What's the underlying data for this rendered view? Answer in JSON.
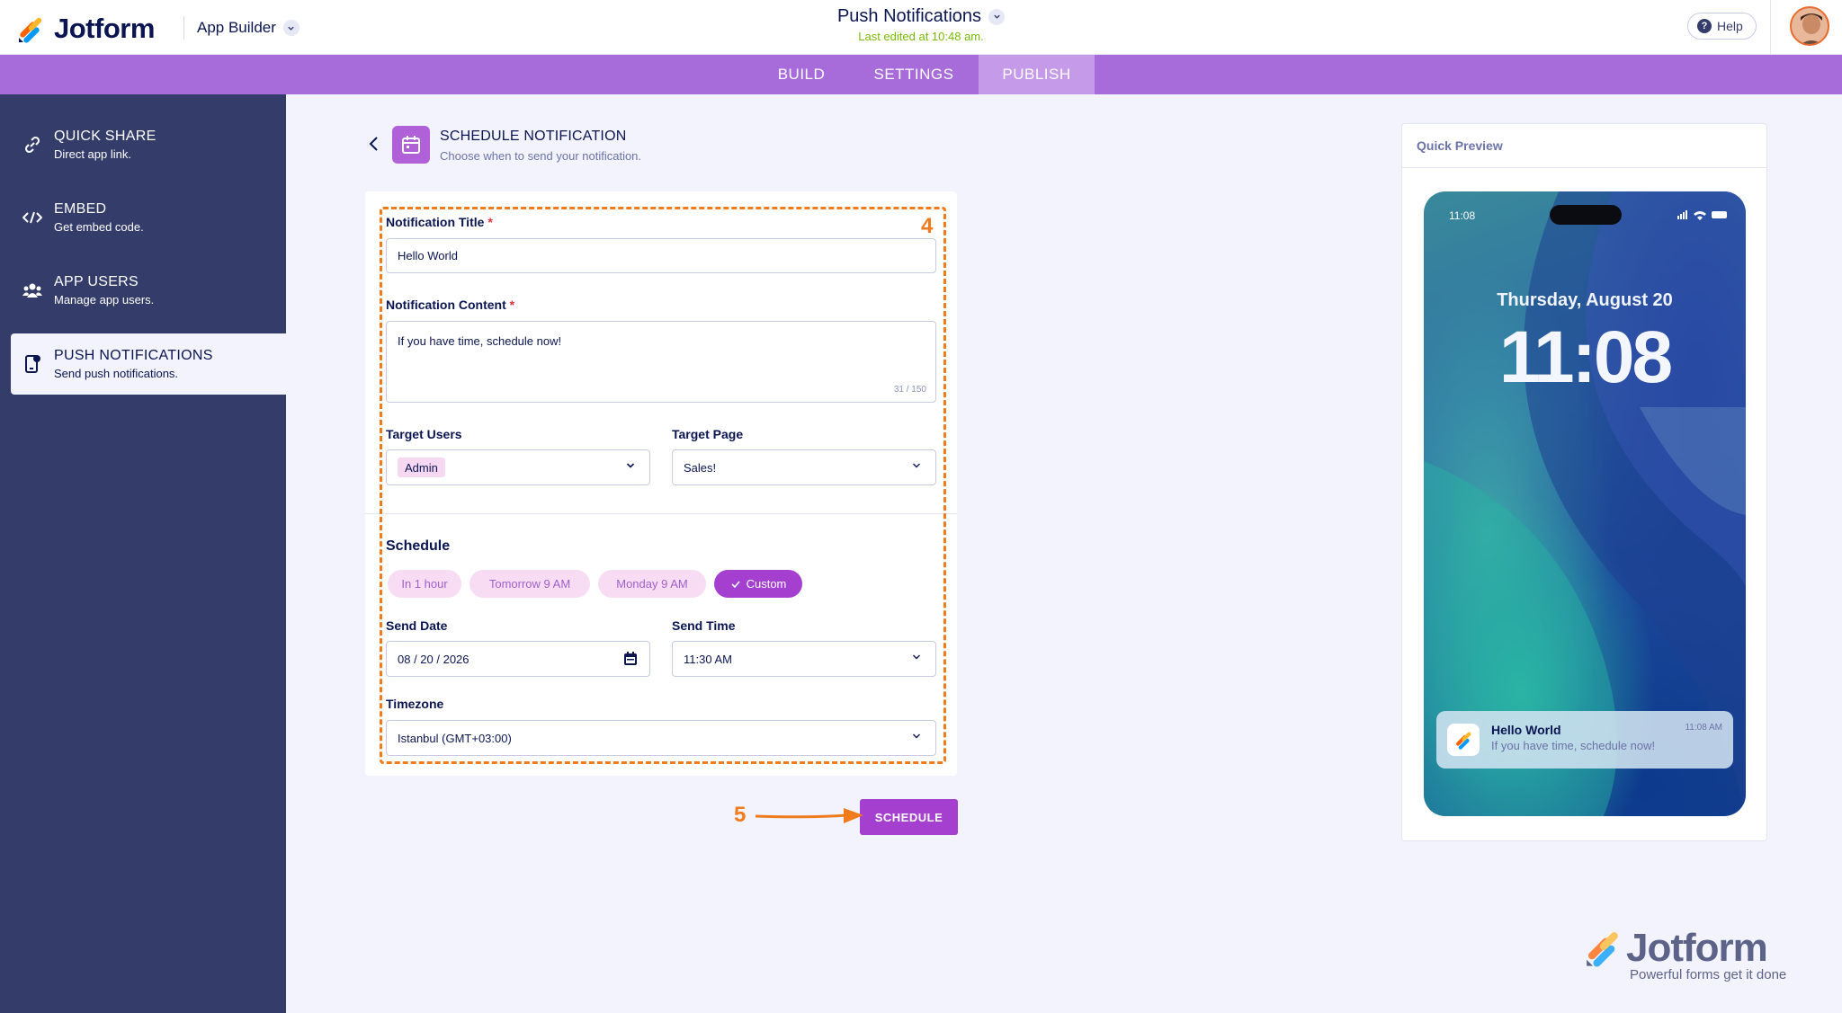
{
  "header": {
    "logo_text": "Jotform",
    "app_builder_label": "App Builder",
    "app_title": "Push Notifications",
    "last_edited": "Last edited at 10:48 am.",
    "help_label": "Help"
  },
  "tabs": [
    {
      "label": "BUILD",
      "active": false
    },
    {
      "label": "SETTINGS",
      "active": false
    },
    {
      "label": "PUBLISH",
      "active": true
    }
  ],
  "sidebar": {
    "items": [
      {
        "title": "QUICK SHARE",
        "subtitle": "Direct app link.",
        "icon": "link-icon",
        "active": false
      },
      {
        "title": "EMBED",
        "subtitle": "Get embed code.",
        "icon": "code-icon",
        "active": false
      },
      {
        "title": "APP USERS",
        "subtitle": "Manage app users.",
        "icon": "users-icon",
        "active": false
      },
      {
        "title": "PUSH NOTIFICATIONS",
        "subtitle": "Send push notifications.",
        "icon": "phone-notification-icon",
        "active": true
      }
    ]
  },
  "schedule_header": {
    "title": "SCHEDULE NOTIFICATION",
    "subtitle": "Choose when to send your notification."
  },
  "form": {
    "notification_title_label": "Notification Title",
    "notification_title_value": "Hello World",
    "notification_content_label": "Notification Content",
    "notification_content_value": "If you have time, schedule now!",
    "char_counter": "31 / 150",
    "required_mark": "*",
    "target_users_label": "Target Users",
    "target_users_value": "Admin",
    "target_page_label": "Target Page",
    "target_page_value": "Sales!",
    "schedule_label": "Schedule",
    "schedule_options": [
      "In 1 hour",
      "Tomorrow 9 AM",
      "Monday 9 AM",
      "Custom"
    ],
    "schedule_selected": "Custom",
    "send_date_label": "Send Date",
    "send_date_value": "08 / 20 / 2026",
    "send_time_label": "Send Time",
    "send_time_value": "11:30 AM",
    "timezone_label": "Timezone",
    "timezone_value": "Istanbul (GMT+03:00)",
    "schedule_button": "SCHEDULE"
  },
  "annotations": {
    "step_4": "4",
    "step_5": "5",
    "color": "#f07b1d"
  },
  "preview": {
    "heading": "Quick Preview",
    "status_time": "11:08",
    "date": "Thursday, August 20",
    "clock": "11:08",
    "notification_title": "Hello World",
    "notification_body": "If you have time, schedule now!",
    "notification_time": "11:08 AM"
  },
  "watermark": {
    "word": "Jotform",
    "tagline": "Powerful forms get it done"
  },
  "colors": {
    "accent_purple": "#a43fd0",
    "tabbar": "#a86bda",
    "sidebar_bg": "#343c6a",
    "navy_text": "#0a1551",
    "edited_green": "#78bb07"
  }
}
